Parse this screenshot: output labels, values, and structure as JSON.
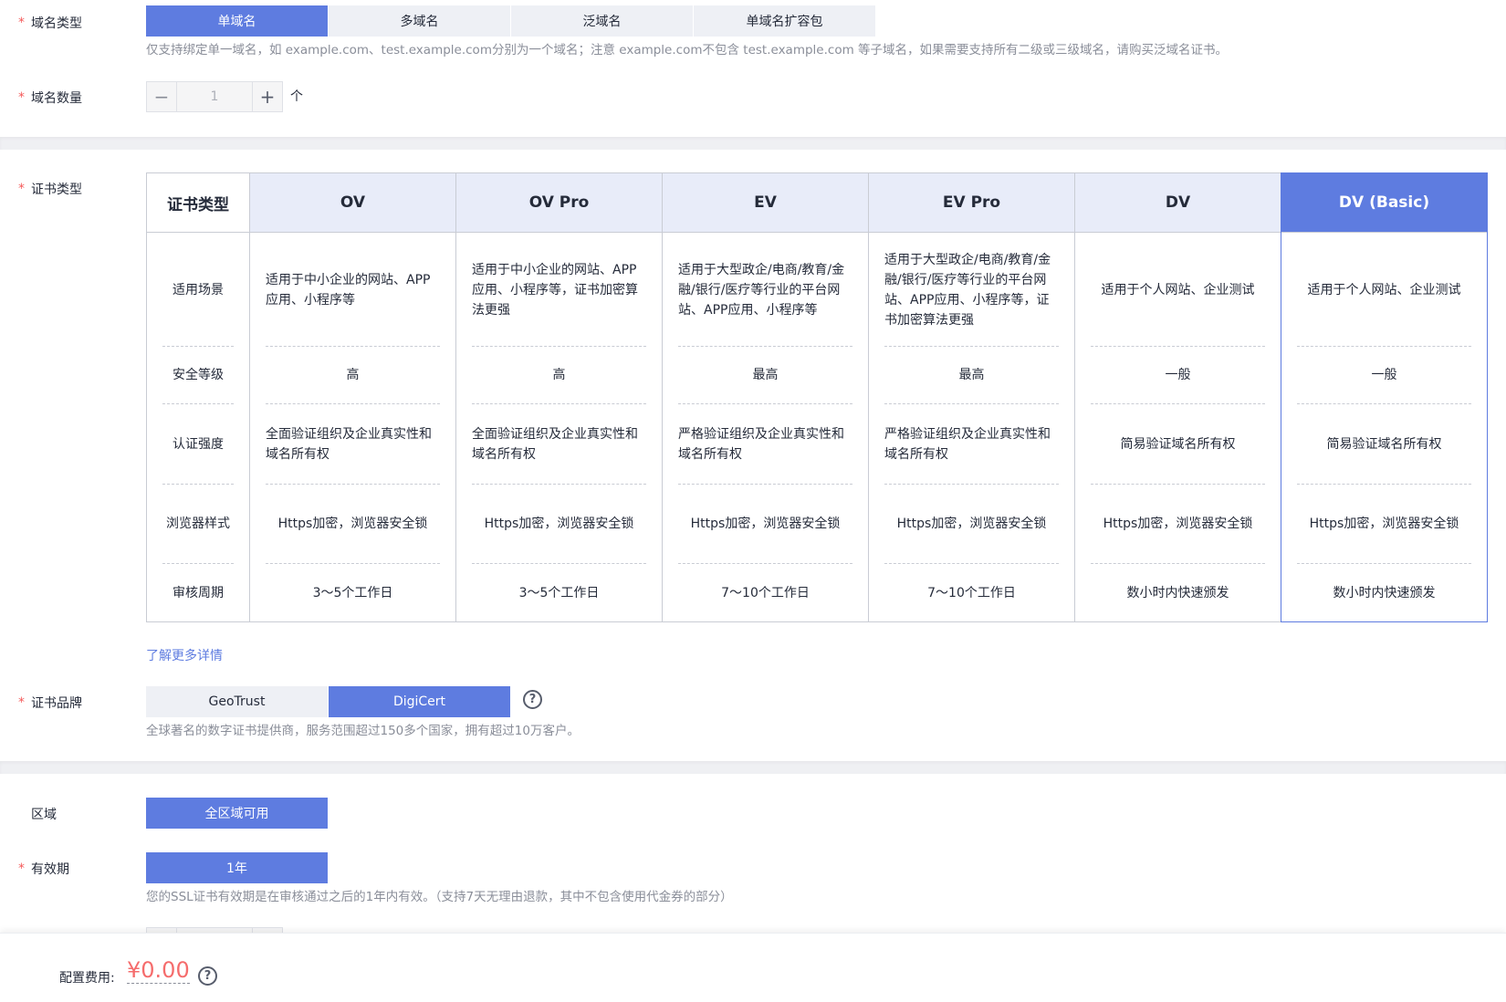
{
  "domain_type": {
    "label": "域名类型",
    "options": [
      "单域名",
      "多域名",
      "泛域名",
      "单域名扩容包"
    ],
    "selected": "单域名",
    "hint": "仅支持绑定单一域名，如 example.com、test.example.com分别为一个域名；注意 example.com不包含 test.example.com 等子域名，如果需要支持所有二级或三级域名，请购买泛域名证书。"
  },
  "domain_count": {
    "label": "域名数量",
    "value": "1",
    "minus": "−",
    "plus": "+",
    "unit": "个"
  },
  "cert_type": {
    "label": "证书类型",
    "header_label": "证书类型",
    "row_labels": [
      "适用场景",
      "安全等级",
      "认证强度",
      "浏览器样式",
      "审核周期"
    ],
    "options": [
      {
        "name": "OV",
        "scenario": "适用于中小企业的网站、APP应用、小程序等",
        "level": "高",
        "auth": "全面验证组织及企业真实性和域名所有权",
        "browser": "Https加密，浏览器安全锁",
        "period": "3～5个工作日"
      },
      {
        "name": "OV Pro",
        "scenario": "适用于中小企业的网站、APP应用、小程序等，证书加密算法更强",
        "level": "高",
        "auth": "全面验证组织及企业真实性和域名所有权",
        "browser": "Https加密，浏览器安全锁",
        "period": "3～5个工作日"
      },
      {
        "name": "EV",
        "scenario": "适用于大型政企/电商/教育/金融/银行/医疗等行业的平台网站、APP应用、小程序等",
        "level": "最高",
        "auth": "严格验证组织及企业真实性和域名所有权",
        "browser": "Https加密，浏览器安全锁",
        "period": "7～10个工作日"
      },
      {
        "name": "EV Pro",
        "scenario": "适用于大型政企/电商/教育/金融/银行/医疗等行业的平台网站、APP应用、小程序等，证书加密算法更强",
        "level": "最高",
        "auth": "严格验证组织及企业真实性和域名所有权",
        "browser": "Https加密，浏览器安全锁",
        "period": "7～10个工作日"
      },
      {
        "name": "DV",
        "scenario": "适用于个人网站、企业测试",
        "level": "一般",
        "auth": "简易验证域名所有权",
        "browser": "Https加密，浏览器安全锁",
        "period": "数小时内快速颁发"
      },
      {
        "name": "DV (Basic)",
        "scenario": "适用于个人网站、企业测试",
        "level": "一般",
        "auth": "简易验证域名所有权",
        "browser": "Https加密，浏览器安全锁",
        "period": "数小时内快速颁发"
      }
    ],
    "selected": "DV (Basic)",
    "more_link": "了解更多详情"
  },
  "cert_brand": {
    "label": "证书品牌",
    "options": [
      "GeoTrust",
      "DigiCert"
    ],
    "selected": "DigiCert",
    "help": "?",
    "hint": "全球著名的数字证书提供商，服务范围超过150多个国家，拥有超过10万客户。"
  },
  "region": {
    "label": "区域",
    "option": "全区域可用"
  },
  "validity": {
    "label": "有效期",
    "option": "1年",
    "hint": "您的SSL证书有效期是在审核通过之后的1年内有效。（支持7天无理由退款，其中不包含使用代金券的部分）"
  },
  "footer": {
    "fee_label": "配置费用:",
    "fee_value": "¥0.00",
    "help": "?"
  },
  "colors": {
    "accent": "#5e7ce0",
    "required": "#f55b5b",
    "price": "#f56c6c",
    "hint": "#8a8e99"
  }
}
